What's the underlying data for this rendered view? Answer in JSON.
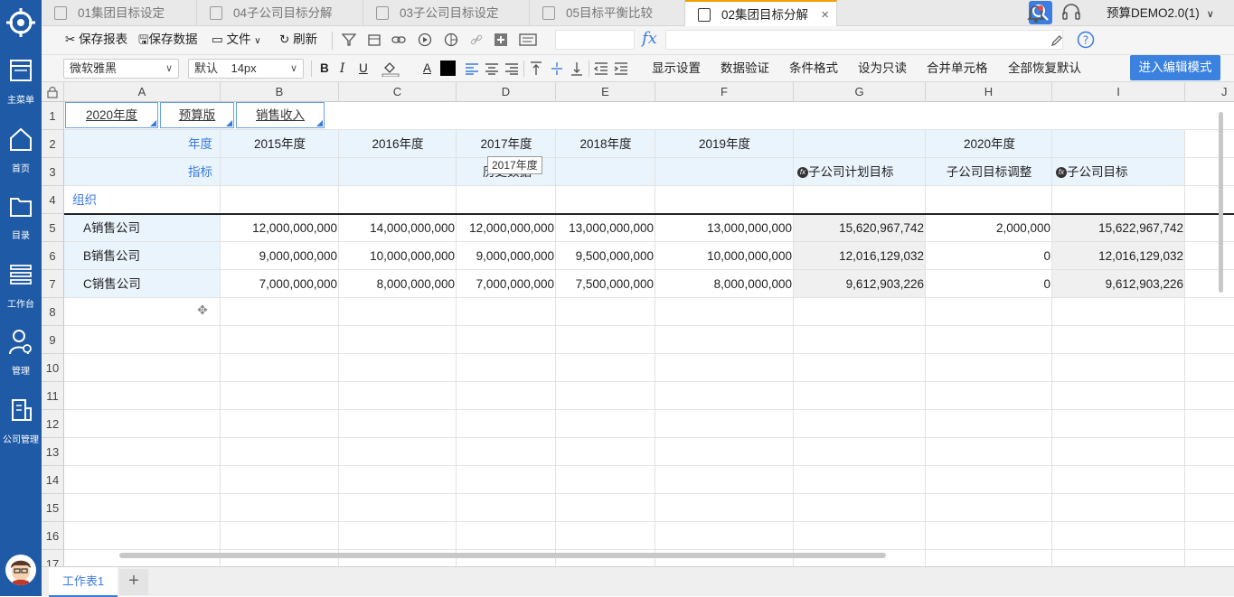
{
  "sidebar": {
    "items": [
      {
        "label": "主菜单",
        "icon": "app-window-icon"
      },
      {
        "label": "首页",
        "icon": "home-icon"
      },
      {
        "label": "目录",
        "icon": "folder-icon"
      },
      {
        "label": "工作台",
        "icon": "list-icon"
      },
      {
        "label": "管理",
        "icon": "user-gear-icon"
      },
      {
        "label": "公司管理",
        "icon": "building-icon"
      }
    ]
  },
  "tabs": [
    {
      "label": "01集团目标设定"
    },
    {
      "label": "04子公司目标分解"
    },
    {
      "label": "03子公司目标设定"
    },
    {
      "label": "05目标平衡比较"
    },
    {
      "label": "02集团目标分解",
      "active": true
    }
  ],
  "topbar": {
    "user": "预算DEMO2.0(1)"
  },
  "toolbar1": {
    "save_report": "保存报表",
    "save_data": "保存数据",
    "file": "文件",
    "refresh": "刷新",
    "fx": "fx"
  },
  "toolbar2": {
    "font_family": "微软雅黑",
    "font_size_mode": "默认",
    "font_size": "14px",
    "bold": "B",
    "italic": "I",
    "underline": "U",
    "font_color_letter": "A",
    "display_settings": "显示设置",
    "data_validation": "数据验证",
    "conditional_format": "条件格式",
    "set_readonly": "设为只读",
    "merge_cells": "合并单元格",
    "restore_defaults": "全部恢复默认",
    "enter_edit_mode": "进入编辑模式"
  },
  "grid": {
    "columns": [
      "A",
      "B",
      "C",
      "D",
      "E",
      "F",
      "G",
      "H",
      "I",
      "J"
    ],
    "rows": [
      "1",
      "2",
      "3",
      "4",
      "5",
      "6",
      "7",
      "8",
      "9",
      "10",
      "11",
      "12",
      "13",
      "14",
      "15",
      "16",
      "17"
    ],
    "filters": [
      "2020年度",
      "预算版",
      "销售收入"
    ],
    "row2": {
      "label": "年度",
      "years": [
        "2015年度",
        "2016年度",
        "2017年度",
        "2018年度",
        "2019年度"
      ],
      "merged_year": "2020年度"
    },
    "row3": {
      "label": "指标",
      "merged_hist": "历史数据",
      "g": "子公司计划目标",
      "h": "子公司目标调整",
      "i": "子公司目标"
    },
    "row4": {
      "label": "组织"
    },
    "data": [
      {
        "org": "A销售公司",
        "values": [
          "12,000,000,000",
          "14,000,000,000",
          "12,000,000,000",
          "13,000,000,000",
          "13,000,000,000",
          "15,620,967,742",
          "2,000,000",
          "15,622,967,742"
        ]
      },
      {
        "org": "B销售公司",
        "values": [
          "9,000,000,000",
          "10,000,000,000",
          "9,000,000,000",
          "9,500,000,000",
          "10,000,000,000",
          "12,016,129,032",
          "0",
          "12,016,129,032"
        ]
      },
      {
        "org": "C销售公司",
        "values": [
          "7,000,000,000",
          "8,000,000,000",
          "7,000,000,000",
          "7,500,000,000",
          "8,000,000,000",
          "9,612,903,226",
          "0",
          "9,612,903,226"
        ]
      }
    ],
    "tooltip": "2017年度"
  },
  "sheets": [
    {
      "label": "工作表1"
    }
  ],
  "colors": {
    "sidebar": "#1f5aa6",
    "accent": "#3b82e0",
    "tab_active_border": "#f2a000",
    "header_band": "#eaf4fd"
  }
}
